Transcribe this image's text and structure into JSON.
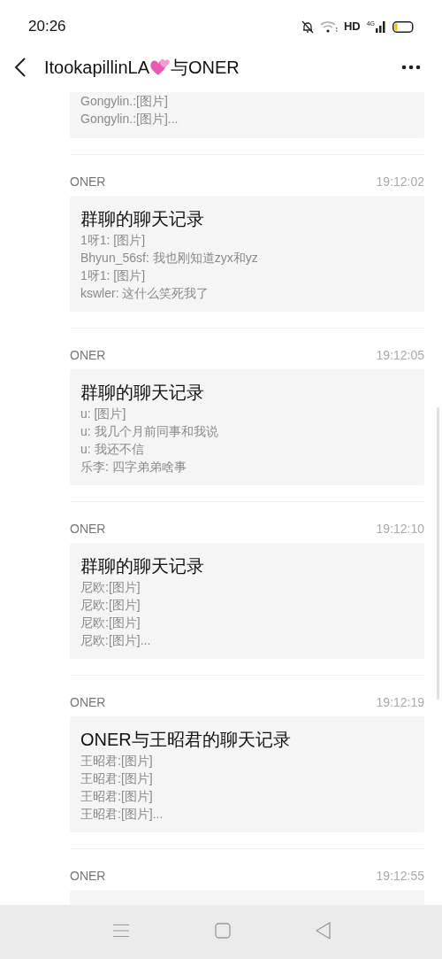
{
  "status_bar": {
    "time": "20:26",
    "hd_label": "HD",
    "network_label": "4G"
  },
  "header": {
    "title_before": "ItookapillinLA",
    "title_after": "与ONER"
  },
  "messages": [
    {
      "lines": [
        "Gongylin.:[图片]",
        "Gongylin.:[图片]..."
      ]
    },
    {
      "sender": "ONER",
      "time": "19:12:02",
      "title": "群聊的聊天记录",
      "lines": [
        "1呀1: [图片]",
        "Bhyun_56sf: 我也刚知道zyx和yz",
        "1呀1: [图片]",
        "kswler: 这什么笑死我了"
      ]
    },
    {
      "sender": "ONER",
      "time": "19:12:05",
      "title": "群聊的聊天记录",
      "lines": [
        "u: [图片]",
        "u: 我几个月前同事和我说",
        "u: 我还不信",
        "乐李: 四字弟弟啥事"
      ]
    },
    {
      "sender": "ONER",
      "time": "19:12:10",
      "title": "群聊的聊天记录",
      "lines": [
        "尼欧:[图片]",
        "尼欧:[图片]",
        "尼欧:[图片]",
        "尼欧:[图片]..."
      ]
    },
    {
      "sender": "ONER",
      "time": "19:12:19",
      "title": "ONER与王昭君的聊天记录",
      "lines": [
        "王昭君:[图片]",
        "王昭君:[图片]",
        "王昭君:[图片]",
        "王昭君:[图片]..."
      ]
    },
    {
      "sender": "ONER",
      "time": "19:12:55"
    }
  ]
}
